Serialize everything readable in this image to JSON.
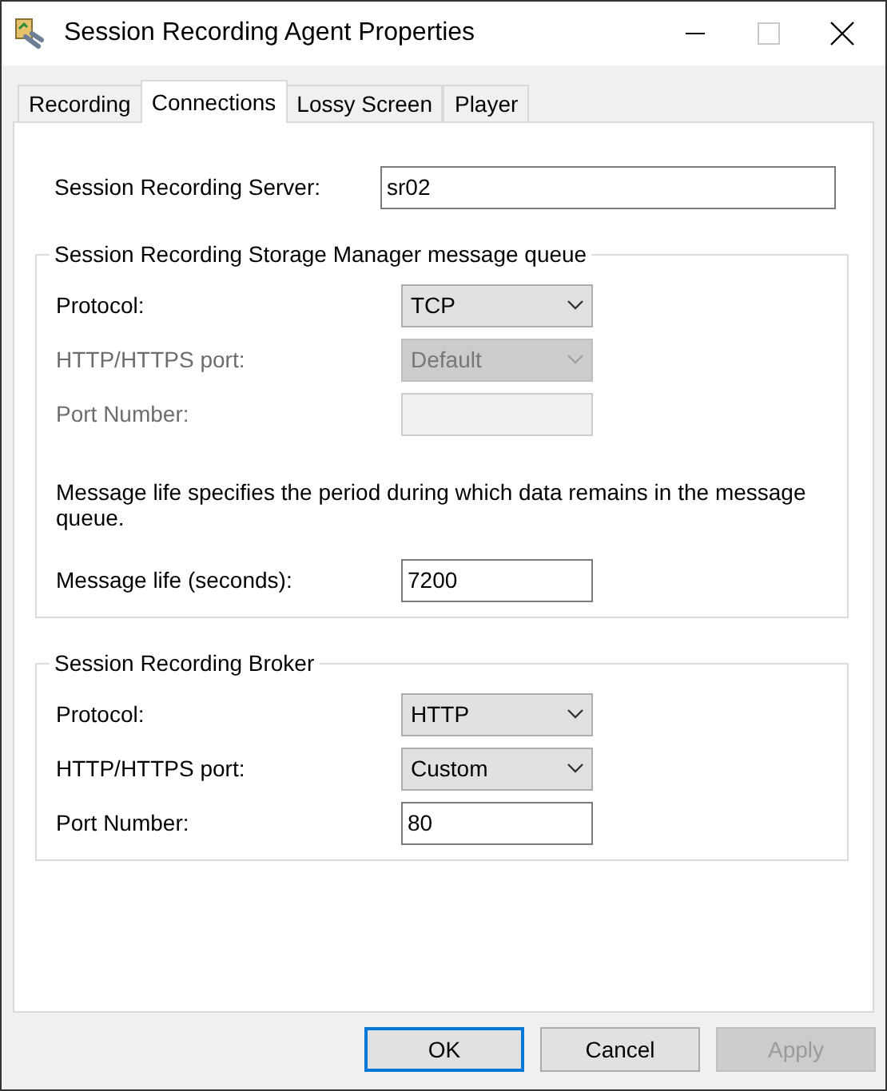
{
  "window": {
    "title": "Session Recording Agent Properties"
  },
  "tabs": [
    {
      "label": "Recording",
      "selected": false
    },
    {
      "label": "Connections",
      "selected": true
    },
    {
      "label": "Lossy Screen",
      "selected": false
    },
    {
      "label": "Player",
      "selected": false
    }
  ],
  "server": {
    "label": "Session Recording Server:",
    "value": "sr02"
  },
  "groups": [
    {
      "title": "Session Recording Storage Manager message queue",
      "fields": [
        {
          "kind": "dropdown",
          "label": "Protocol:",
          "value": "TCP",
          "disabled": false
        },
        {
          "kind": "dropdown",
          "label": "HTTP/HTTPS port:",
          "value": "Default",
          "disabled": true
        },
        {
          "kind": "text",
          "label": "Port Number:",
          "disabled": true
        },
        {
          "kind": "note",
          "text": "Message life specifies the period during which data remains in the message queue."
        },
        {
          "kind": "text",
          "label": "Message life (seconds):",
          "value": "7200",
          "disabled": false
        }
      ]
    },
    {
      "title": "Session Recording Broker",
      "fields": [
        {
          "kind": "dropdown",
          "label": "Protocol:",
          "value": "HTTP",
          "disabled": false
        },
        {
          "kind": "dropdown",
          "label": "HTTP/HTTPS port:",
          "value": "Custom",
          "disabled": false
        },
        {
          "kind": "text",
          "label": "Port Number:",
          "value": "80",
          "disabled": false
        }
      ]
    }
  ],
  "buttons": [
    {
      "label": "OK",
      "default": true,
      "disabled": false
    },
    {
      "label": "Cancel",
      "default": false,
      "disabled": false
    },
    {
      "label": "Apply",
      "default": false,
      "disabled": true
    }
  ]
}
